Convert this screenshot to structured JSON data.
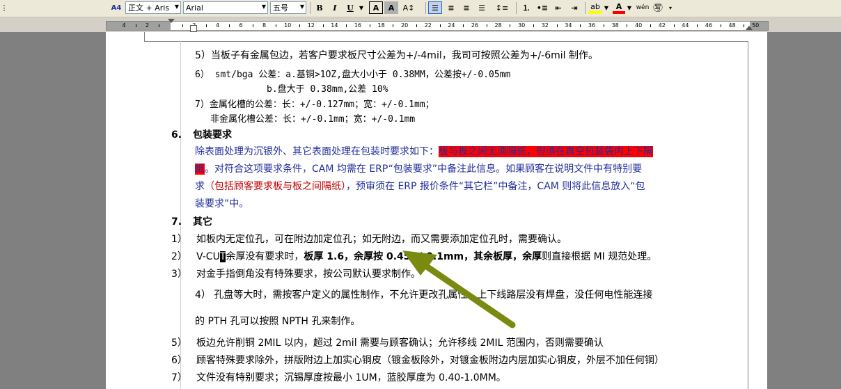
{
  "toolbar": {
    "style_icon": "A4",
    "style_value": "正文 + Aris",
    "font_value": "Arial",
    "size_value": "五号",
    "bold": "B",
    "italic": "I",
    "underline": "U",
    "char_border": "A",
    "char_shade": "A",
    "phonetic": "wén",
    "accent_highlight": "#ffff00",
    "accent_fontcolor": "#ff0000"
  },
  "ruler": {
    "numbers": [
      "4",
      "2",
      "",
      "2",
      "4",
      "6",
      "8",
      "10",
      "12",
      "14",
      "16",
      "18",
      "20",
      "22",
      "24",
      "26",
      "28",
      "30",
      "32",
      "34",
      "36",
      "38",
      "40",
      "42",
      "44",
      "46",
      "48",
      "50"
    ]
  },
  "doc": {
    "l5": "5）当板子有金属包边，若客户要求板尺寸公差为+/-4mil，我司可按照公差为+/-6mil 制作。",
    "l6a": "6）  smt/bga 公差：a.基铜>1OZ,盘大小小于 0.38MM，公差按+/-0.05mm",
    "l6b": "b.盘大于 0.38mm,公差 10%",
    "l7a": "7）金属化槽的公差：长：+/-0.127mm；宽：+/-0.1mm；",
    "l7b": "非金属化槽公差：长：+/-0.1mm；宽：+/-0.1mm",
    "h6_num": "6.",
    "h6_title": "包装要求",
    "p1_a": "除表面处理为沉银外、其它表面处理在包装时要求如下：",
    "p1_hl": "板与板之间无须隔纸，但须在真空包装袋内上下隔",
    "p2_hl": "纸",
    "p2_a": "。对符合这项要求条件，CAM 均需在 ERP“包装要求”中备注此信息。如果顾客在说明文件中有特别要",
    "p3_a": "求",
    "p3_red": "（包括顾客要求板与板之间隔纸）",
    "p3_b": "，预审须在 ERP 报价条件“其它栏”中备注，CAM 则将此信息放入“包",
    "p4_a": "装要求”中。",
    "h7_num": "7.",
    "h7_title": "其它",
    "o1_num": "1）",
    "o1_text": "如板内无定位孔，可在附边加定位孔；如无附边，而又需要添加定位孔时，需要确认。",
    "o2_num": "2）",
    "o2_a": "V-CU",
    "o2_cursor": "T",
    "o2_b": "余厚没有要求时，",
    "o2_bold": "板厚 1.6，余厚按 0.45+/-0.1mm，其余板厚，余厚",
    "o2_c": "则直接根据 MI 规范处理。",
    "o3_num": "3）",
    "o3_text": "对金手指倒角没有特殊要求，按公司默认要求制作。",
    "o4_text": "4）  孔盘等大时，需按客户定义的属性制作，不允许更改孔属性。上下线路层没有焊盘，没任何电性能连接",
    "o4b_text": "的 PTH 孔可以按照 NPTH 孔来制作。",
    "o5_num": "5）",
    "o5_text": "板边允许削铜 2MIL 以内，超过 2mil 需要与顾客确认；允许移线 2MIL 范围内，否则需要确认",
    "o6_num": "6）",
    "o6_text": "顾客特殊要求除外，拼版附边上加实心铜皮（镀金板除外，对镀金板附边内层加实心铜皮，外层不加任何铜）",
    "o7_num": "7）",
    "o7_text": "文件没有特别要求；沉锡厚度按最小 1UM，蓝胶厚度为 0.40-1.0MM。"
  },
  "colors": {
    "text_blue": "#1f2f9c",
    "text_red": "#c00000",
    "highlight": "#ff0000",
    "arrow": "#7a8a10"
  }
}
